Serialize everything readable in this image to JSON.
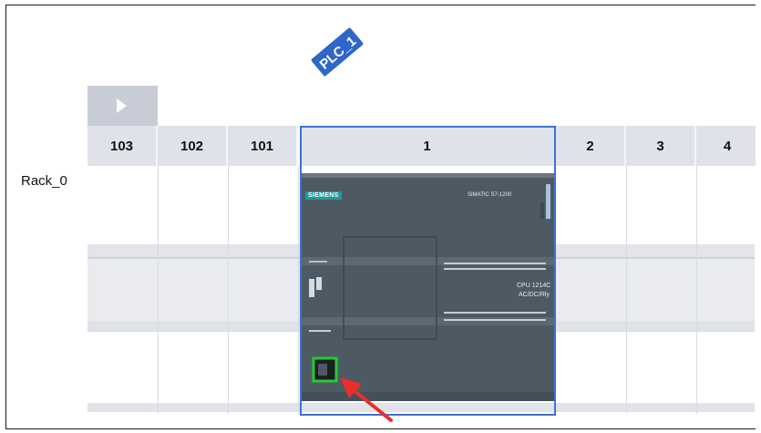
{
  "device": {
    "name": "PLC_1",
    "rack_name": "Rack_0"
  },
  "slots": [
    "103",
    "102",
    "101",
    "1",
    "2",
    "3",
    "4"
  ],
  "cpu": {
    "brand": "SIEMENS",
    "family": "SIMATIC S7-1200",
    "model_line1": "CPU 1214C",
    "model_line2": "AC/DC/Rly"
  },
  "colors": {
    "accent": "#3d72d6",
    "plc_tag": "#2e66c9",
    "port_highlight": "#22cc33",
    "arrow": "#e8302a",
    "cpu_body": "#4e5a63",
    "siemens_badge": "#1e9aa0"
  },
  "icons": {
    "expand": "triangle-right-icon",
    "port": "ethernet-port-icon",
    "annotation": "red-arrow-icon"
  }
}
